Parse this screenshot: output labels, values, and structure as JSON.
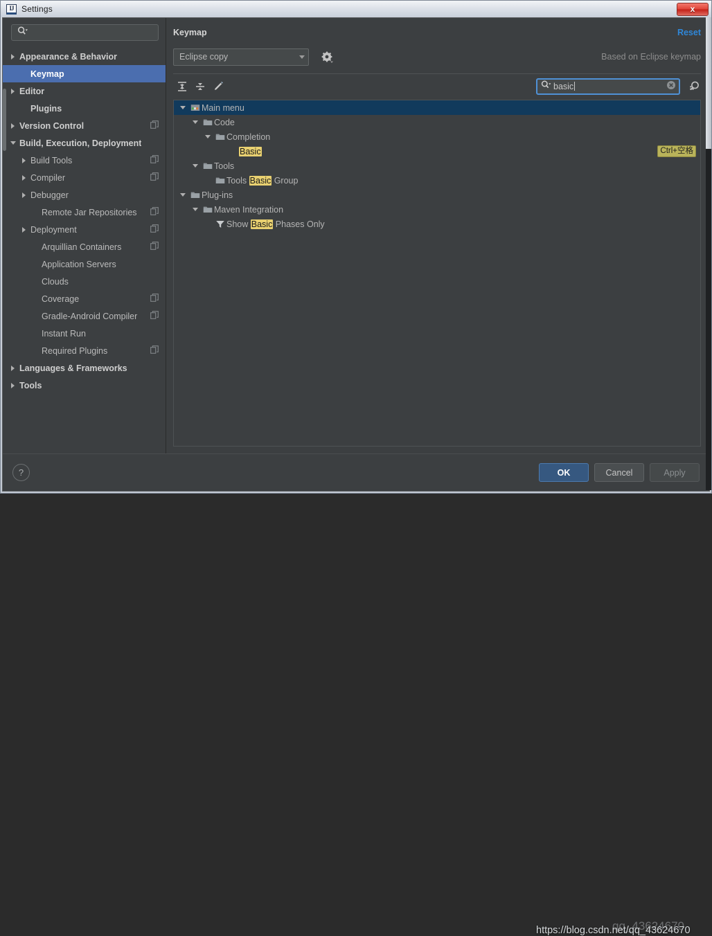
{
  "window": {
    "title": "Settings",
    "app_icon": "IJ",
    "close_label": "x"
  },
  "sidebar": {
    "search_placeholder": "",
    "search_value": "",
    "items": [
      {
        "label": "Appearance & Behavior",
        "indent": 0,
        "expander": "right",
        "bold": true,
        "selected": false,
        "copy": false
      },
      {
        "label": "Keymap",
        "indent": 1,
        "expander": "none",
        "bold": true,
        "selected": true,
        "copy": false
      },
      {
        "label": "Editor",
        "indent": 0,
        "expander": "right",
        "bold": true,
        "selected": false,
        "copy": false
      },
      {
        "label": "Plugins",
        "indent": 1,
        "expander": "none",
        "bold": true,
        "selected": false,
        "copy": false
      },
      {
        "label": "Version Control",
        "indent": 0,
        "expander": "right",
        "bold": true,
        "selected": false,
        "copy": true
      },
      {
        "label": "Build, Execution, Deployment",
        "indent": 0,
        "expander": "down",
        "bold": true,
        "selected": false,
        "copy": false
      },
      {
        "label": "Build Tools",
        "indent": 1,
        "expander": "right",
        "bold": false,
        "selected": false,
        "copy": true
      },
      {
        "label": "Compiler",
        "indent": 1,
        "expander": "right",
        "bold": false,
        "selected": false,
        "copy": true
      },
      {
        "label": "Debugger",
        "indent": 1,
        "expander": "right",
        "bold": false,
        "selected": false,
        "copy": false
      },
      {
        "label": "Remote Jar Repositories",
        "indent": 2,
        "expander": "none",
        "bold": false,
        "selected": false,
        "copy": true
      },
      {
        "label": "Deployment",
        "indent": 1,
        "expander": "right",
        "bold": false,
        "selected": false,
        "copy": true
      },
      {
        "label": "Arquillian Containers",
        "indent": 2,
        "expander": "none",
        "bold": false,
        "selected": false,
        "copy": true
      },
      {
        "label": "Application Servers",
        "indent": 2,
        "expander": "none",
        "bold": false,
        "selected": false,
        "copy": false
      },
      {
        "label": "Clouds",
        "indent": 2,
        "expander": "none",
        "bold": false,
        "selected": false,
        "copy": false
      },
      {
        "label": "Coverage",
        "indent": 2,
        "expander": "none",
        "bold": false,
        "selected": false,
        "copy": true
      },
      {
        "label": "Gradle-Android Compiler",
        "indent": 2,
        "expander": "none",
        "bold": false,
        "selected": false,
        "copy": true
      },
      {
        "label": "Instant Run",
        "indent": 2,
        "expander": "none",
        "bold": false,
        "selected": false,
        "copy": false
      },
      {
        "label": "Required Plugins",
        "indent": 2,
        "expander": "none",
        "bold": false,
        "selected": false,
        "copy": true
      },
      {
        "label": "Languages & Frameworks",
        "indent": 0,
        "expander": "right",
        "bold": true,
        "selected": false,
        "copy": false
      },
      {
        "label": "Tools",
        "indent": 0,
        "expander": "right",
        "bold": true,
        "selected": false,
        "copy": false
      }
    ]
  },
  "main": {
    "page_title": "Keymap",
    "reset_label": "Reset",
    "keymap_select": {
      "value": "Eclipse copy",
      "options": [
        "Eclipse copy"
      ]
    },
    "based_on": "Based on Eclipse keymap",
    "toolbar": {
      "expand_all": "expand-all",
      "collapse_all": "collapse-all",
      "edit_shortcut": "edit-shortcut"
    },
    "search": {
      "value": "basic",
      "placeholder": "",
      "clear_label": "×",
      "find_by_shortcut": "find-by-shortcut"
    }
  },
  "tree": {
    "highlight_term": "Basic",
    "highlight_color": "#e8d070",
    "rows": [
      {
        "indent": 0,
        "expander": "down",
        "icon": "menu",
        "prefix": "Main menu",
        "match": "",
        "suffix": "",
        "selected": true,
        "shortcut": ""
      },
      {
        "indent": 1,
        "expander": "down",
        "icon": "folder",
        "prefix": "Code",
        "match": "",
        "suffix": "",
        "selected": false,
        "shortcut": ""
      },
      {
        "indent": 2,
        "expander": "down",
        "icon": "folder",
        "prefix": "Completion",
        "match": "",
        "suffix": "",
        "selected": false,
        "shortcut": ""
      },
      {
        "indent": 3,
        "expander": "none",
        "icon": "none",
        "prefix": "",
        "match": "Basic",
        "suffix": "",
        "selected": false,
        "shortcut": "Ctrl+空格"
      },
      {
        "indent": 1,
        "expander": "down",
        "icon": "folder",
        "prefix": "Tools",
        "match": "",
        "suffix": "",
        "selected": false,
        "shortcut": ""
      },
      {
        "indent": 2,
        "expander": "none",
        "icon": "folder",
        "prefix": "Tools ",
        "match": "Basic",
        "suffix": " Group",
        "selected": false,
        "shortcut": ""
      },
      {
        "indent": 0,
        "expander": "down",
        "icon": "folder",
        "prefix": "Plug-ins",
        "match": "",
        "suffix": "",
        "selected": false,
        "shortcut": ""
      },
      {
        "indent": 1,
        "expander": "down",
        "icon": "folder",
        "prefix": "Maven Integration",
        "match": "",
        "suffix": "",
        "selected": false,
        "shortcut": ""
      },
      {
        "indent": 2,
        "expander": "none",
        "icon": "filter",
        "prefix": "Show ",
        "match": "Basic",
        "suffix": " Phases Only",
        "selected": false,
        "shortcut": ""
      }
    ]
  },
  "footer": {
    "help_label": "?",
    "ok_label": "OK",
    "cancel_label": "Cancel",
    "apply_label": "Apply"
  },
  "watermark": {
    "url": "https://blog.csdn.net/qq_43624670",
    "id": "qq_43624670"
  }
}
